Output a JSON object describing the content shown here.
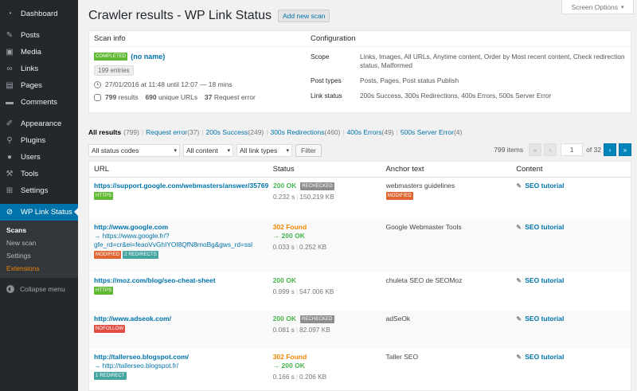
{
  "sidebar": {
    "items": [
      {
        "label": "Dashboard"
      },
      {
        "label": "Posts"
      },
      {
        "label": "Media"
      },
      {
        "label": "Links"
      },
      {
        "label": "Pages"
      },
      {
        "label": "Comments"
      },
      {
        "label": "Appearance"
      },
      {
        "label": "Plugins"
      },
      {
        "label": "Users"
      },
      {
        "label": "Tools"
      },
      {
        "label": "Settings"
      },
      {
        "label": "WP Link Status"
      }
    ],
    "submenu": [
      {
        "label": "Scans"
      },
      {
        "label": "New scan"
      },
      {
        "label": "Settings"
      },
      {
        "label": "Extensions"
      }
    ],
    "collapse_label": "Collapse menu"
  },
  "header": {
    "screen_options": "Screen Options",
    "title": "Crawler results - WP Link Status",
    "add_new": "Add new scan"
  },
  "scan_info": {
    "heading": "Scan info",
    "status_badge": "COMPLETED",
    "name": "(no name)",
    "entries": "199 entries",
    "dates": "27/01/2016 at 11:48 until 12:07 — 18 mins",
    "results": "799",
    "results_label": "results",
    "unique": "690",
    "unique_label": "unique URLs",
    "request_error": "37",
    "request_error_label": "Request error"
  },
  "configuration": {
    "heading": "Configuration",
    "rows": [
      {
        "label": "Scope",
        "value": "Links, Images, All URLs, Anytime content, Order by Most recent content, Check redirection status, Malformed"
      },
      {
        "label": "Post types",
        "value": "Posts, Pages, Post status Publish"
      },
      {
        "label": "Link status",
        "value": "200s Success, 300s Redirections, 400s Errors, 500s Server Error"
      }
    ]
  },
  "filters": [
    {
      "label": "All results",
      "count": "(799)"
    },
    {
      "label": "Request error",
      "count": "(37)"
    },
    {
      "label": "200s Success",
      "count": "(249)"
    },
    {
      "label": "300s Redirections",
      "count": "(460)"
    },
    {
      "label": "400s Errors",
      "count": "(49)"
    },
    {
      "label": "500s Server Error",
      "count": "(4)"
    }
  ],
  "toolbar": {
    "status_select": "All status codes",
    "content_select": "All content",
    "link_select": "All link types",
    "filter_button": "Filter",
    "items_count": "799 items",
    "page_current": "1",
    "page_total": "of 32",
    "first": "«",
    "prev": "‹",
    "next": "›",
    "last": "»"
  },
  "table": {
    "columns": [
      "URL",
      "Status",
      "Anchor text",
      "Content"
    ],
    "rows": [
      {
        "url": "https://support.google.com/webmasters/answer/35769",
        "redirect": "",
        "badges": [
          "HTTPS"
        ],
        "status": "200 OK",
        "redirect_status": "",
        "status_badge": "RECHECKED",
        "time": "0.232 s",
        "size": "150.219 KB",
        "anchor": "webmasters guidelines",
        "anchor_badge": "MODIFIED",
        "content": "SEO tutorial"
      },
      {
        "url": "http://www.google.com",
        "redirect": "→ https://www.google.fr/?gfe_rd=cr&ei=feaoVvGhIYOI8QfN8rnoBg&gws_rd=ssl",
        "badges": [
          "MODIFIED",
          "2 REDIRECTS"
        ],
        "status": "302 Found",
        "redirect_status": "→ 200 OK",
        "status_badge": "",
        "time": "0.033 s",
        "size": "0.252 KB",
        "anchor": "Google Webmaster Tools",
        "anchor_badge": "",
        "content": "SEO tutorial"
      },
      {
        "url": "https://moz.com/blog/seo-cheat-sheet",
        "redirect": "",
        "badges": [
          "HTTPS"
        ],
        "status": "200 OK",
        "redirect_status": "",
        "status_badge": "",
        "time": "0.999 s",
        "size": "547.006 KB",
        "anchor": "chuleta SEO de SEOMoz",
        "anchor_badge": "",
        "content": "SEO tutorial"
      },
      {
        "url": "http://www.adseok.com/",
        "redirect": "",
        "badges": [
          "NOFOLLOW"
        ],
        "status": "200 OK",
        "redirect_status": "",
        "status_badge": "RECHECKED",
        "time": "0.081 s",
        "size": "82.097 KB",
        "anchor": "adSeOk",
        "anchor_badge": "",
        "content": "SEO tutorial"
      },
      {
        "url": "http://tallerseo.blogspot.com/",
        "redirect": "→ http://tallerseo.blogspot.fr/",
        "badges": [
          "1 REDIRECT"
        ],
        "status": "302 Found",
        "redirect_status": "→ 200 OK",
        "status_badge": "",
        "time": "0.166 s",
        "size": "0.206 KB",
        "anchor": "Taller SEO",
        "anchor_badge": "",
        "content": "SEO tutorial"
      }
    ]
  },
  "colors": {
    "sidebar_bg": "#23282d",
    "accent": "#0073aa",
    "ok": "#46b450",
    "found": "#f18500"
  }
}
